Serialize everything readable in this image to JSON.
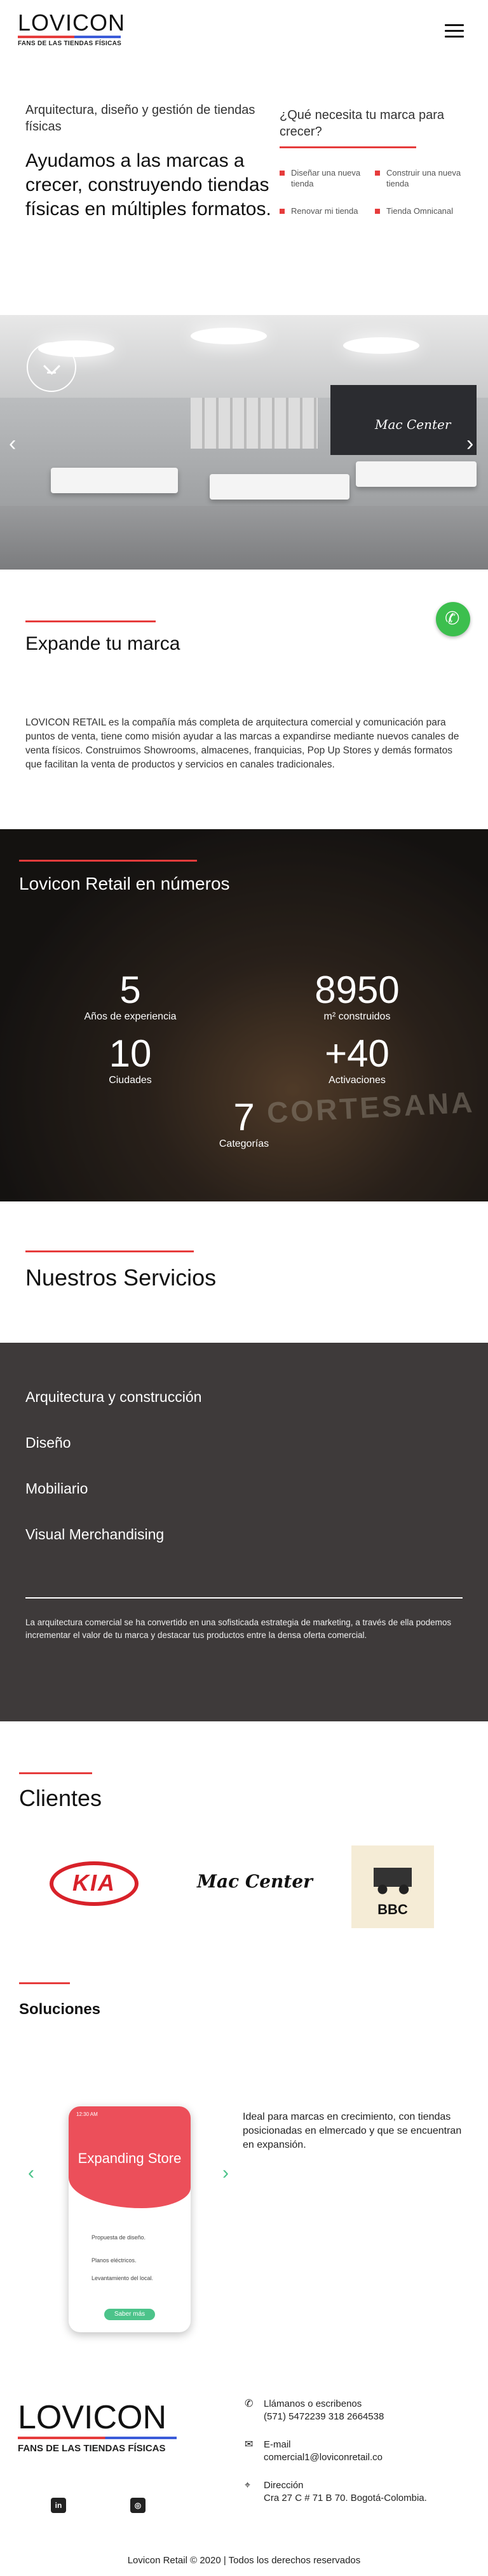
{
  "header": {
    "logo_word": "LOVICON",
    "logo_tagline": "FANS DE LAS TIENDAS FÍSICAS"
  },
  "intro": {
    "subtitle": "Arquitectura, diseño y gestión de tiendas físicas",
    "headline": "Ayudamos a las marcas a crecer, construyendo tiendas físicas en múltiples formatos."
  },
  "need": {
    "question": "¿Qué necesita tu marca para crecer?",
    "options": [
      "Diseñar una nueva tienda",
      "Construir una nueva tienda",
      "Renovar mi tienda",
      "Tienda Omnicanal"
    ]
  },
  "hero": {
    "wall_sign": "Mac Center",
    "prev": "‹",
    "next": "›"
  },
  "expand": {
    "title": "Expande tu marca",
    "paragraph": "LOVICON RETAIL es la compañía más completa de arquitectura comercial y comunicación para puntos de venta, tiene como misión ayudar a las marcas a expandirse mediante nuevos canales de venta físicos. Construimos Showrooms, almacenes, franquicias, Pop Up Stores y demás formatos que facilitan la venta de productos y servicios en canales tradicionales."
  },
  "stats": {
    "title": "Lovicon Retail en números",
    "bg_sign": "CORTESANA",
    "items": [
      {
        "n": "5",
        "l": "Años de experiencia"
      },
      {
        "n": "8950",
        "l": "m² construidos"
      },
      {
        "n": "10",
        "l": "Ciudades"
      },
      {
        "n": "+40",
        "l": "Activaciones"
      },
      {
        "n": "7",
        "l": "Categorías"
      }
    ]
  },
  "services": {
    "title": "Nuestros Servicios",
    "items": [
      "Arquitectura y construcción",
      "Diseño",
      "Mobiliario",
      "Visual Merchandising"
    ],
    "text": "La arquitectura comercial se ha convertido en una sofisticada estrategia de marketing, a través de ella podemos incrementar el valor de tu marca y destacar tus productos entre la densa oferta comercial."
  },
  "clients": {
    "title": "Clientes",
    "kia": "KIA",
    "mac": "Mac Center",
    "bbc": "BBC"
  },
  "solutions": {
    "title": "Soluciones",
    "phone_time": "12:30 AM",
    "phone_title": "Expanding Store",
    "phone_items": [
      "Propuesta de diseño.",
      "Planos eléctricos.",
      "Levantamiento del local."
    ],
    "phone_button": "Saber más",
    "prev": "‹",
    "next": "›",
    "text": "Ideal para marcas en crecimiento, con tiendas posicionadas en elmercado y que se encuentran en expansión."
  },
  "footer": {
    "logo_word": "LOVICON",
    "logo_tagline": "FANS DE LAS TIENDAS FÍSICAS",
    "call_label": "Llámanos o escribenos",
    "phones": "(571) 5472239 318 2664538",
    "email_label": "E-mail",
    "email": "comercial1@loviconretail.co",
    "address_label": "Dirección",
    "address": "Cra 27 C # 71 B 70. Bogotá-Colombia.",
    "linkedin": "in",
    "instagram": "◎",
    "copyright": "Lovicon Retail © 2020 | Todos los derechos reservados"
  },
  "colors": {
    "accent": "#e63c3c",
    "dark": "#3e3a3a",
    "green": "#4cc38a"
  }
}
